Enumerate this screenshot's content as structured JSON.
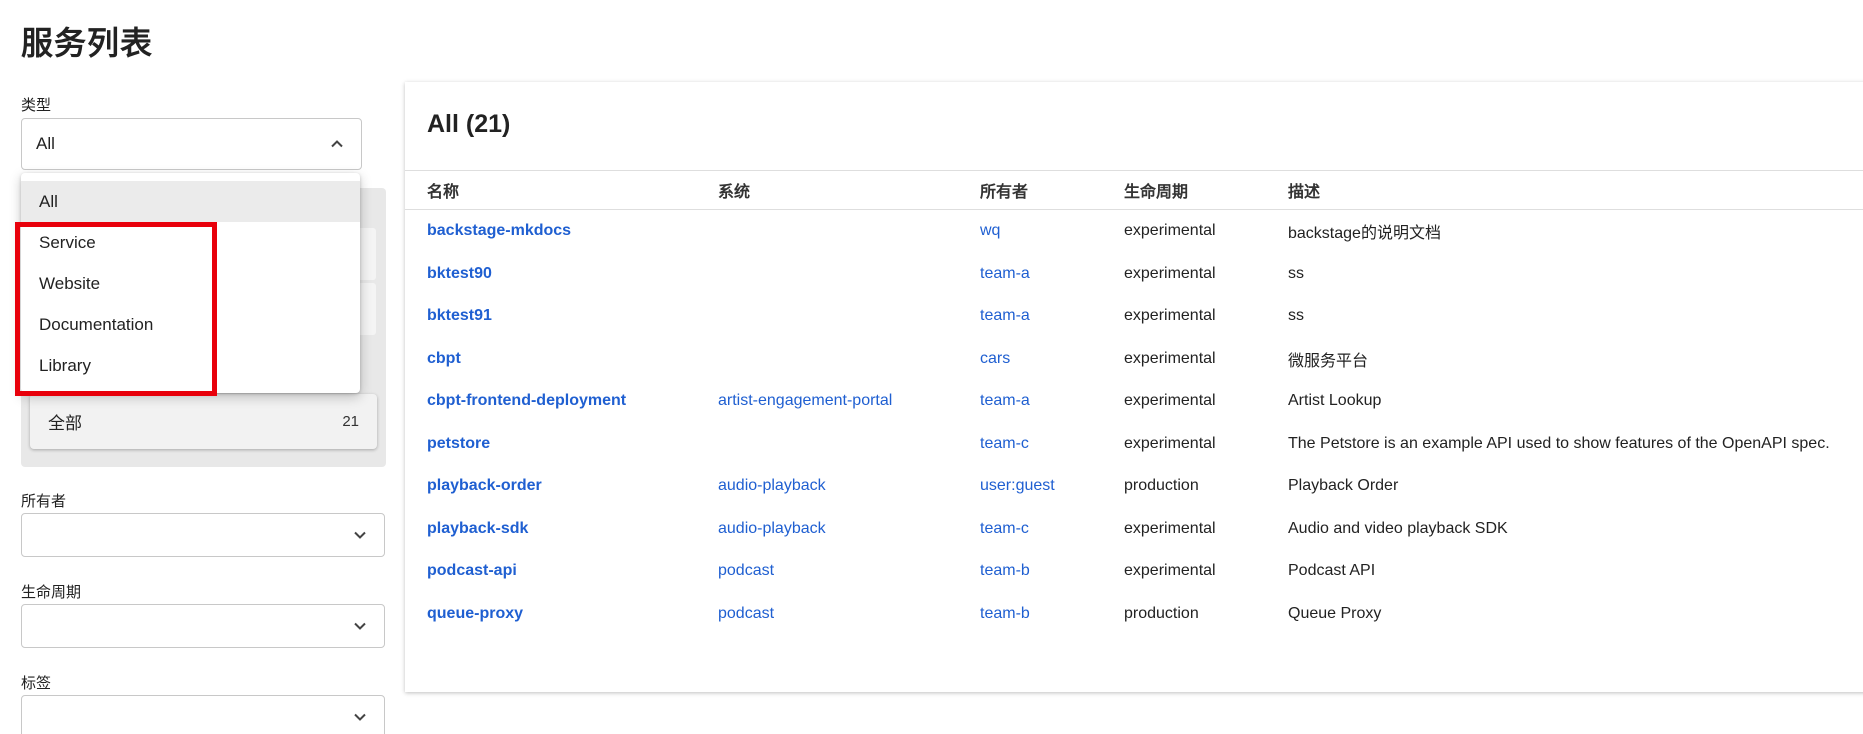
{
  "page": {
    "title": "服务列表"
  },
  "filters": {
    "type": {
      "label": "类型",
      "value": "All",
      "options": [
        {
          "label": "All",
          "selected": true
        },
        {
          "label": "Service",
          "selected": false
        },
        {
          "label": "Website",
          "selected": false
        },
        {
          "label": "Documentation",
          "selected": false
        },
        {
          "label": "Library",
          "selected": false
        }
      ]
    },
    "user_filter": {
      "all_label": "全部",
      "all_count": "21"
    },
    "owner": {
      "label": "所有者",
      "value": ""
    },
    "lifecycle": {
      "label": "生命周期",
      "value": ""
    },
    "tags": {
      "label": "标签",
      "value": ""
    }
  },
  "table": {
    "title": "All (21)",
    "columns": [
      "名称",
      "系统",
      "所有者",
      "生命周期",
      "描述"
    ],
    "rows": [
      {
        "name": "backstage-mkdocs",
        "system": "",
        "owner": "wq",
        "lifecycle": "experimental",
        "description": "backstage的说明文档"
      },
      {
        "name": "bktest90",
        "system": "",
        "owner": "team-a",
        "lifecycle": "experimental",
        "description": "ss"
      },
      {
        "name": "bktest91",
        "system": "",
        "owner": "team-a",
        "lifecycle": "experimental",
        "description": "ss"
      },
      {
        "name": "cbpt",
        "system": "",
        "owner": "cars",
        "lifecycle": "experimental",
        "description": "微服务平台"
      },
      {
        "name": "cbpt-frontend-deployment",
        "system": "artist-engagement-portal",
        "owner": "team-a",
        "lifecycle": "experimental",
        "description": "Artist Lookup"
      },
      {
        "name": "petstore",
        "system": "",
        "owner": "team-c",
        "lifecycle": "experimental",
        "description": "The Petstore is an example API used to show features of the OpenAPI spec."
      },
      {
        "name": "playback-order",
        "system": "audio-playback",
        "owner": "user:guest",
        "lifecycle": "production",
        "description": "Playback Order"
      },
      {
        "name": "playback-sdk",
        "system": "audio-playback",
        "owner": "team-c",
        "lifecycle": "experimental",
        "description": "Audio and video playback SDK"
      },
      {
        "name": "podcast-api",
        "system": "podcast",
        "owner": "team-b",
        "lifecycle": "experimental",
        "description": "Podcast API"
      },
      {
        "name": "queue-proxy",
        "system": "podcast",
        "owner": "team-b",
        "lifecycle": "production",
        "description": "Queue Proxy"
      }
    ]
  },
  "icons": {
    "chevron_up": "chevron-up-icon",
    "chevron_down": "chevron-down-icon"
  },
  "colors": {
    "link": "#1f5fd1",
    "highlight": "#e8000b",
    "menu_selected": "#ebebeb",
    "panel": "#e8e8e8"
  }
}
